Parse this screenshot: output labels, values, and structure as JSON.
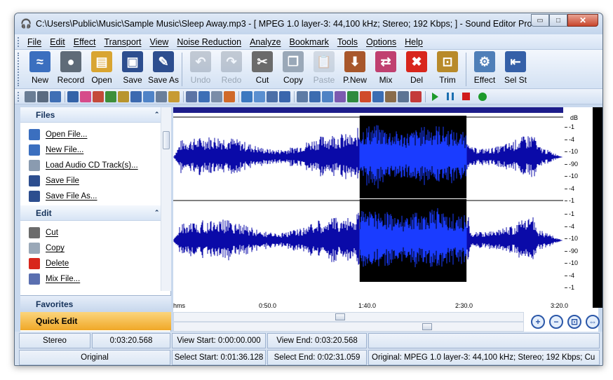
{
  "window": {
    "title": "C:\\Users\\Public\\Music\\Sample Music\\Sleep Away.mp3 - [ MPEG 1.0 layer-3: 44,100 kHz; Stereo; 192 Kbps;  ] - Sound Editor Pro",
    "minimize": "▭",
    "maximize": "□",
    "close": "✕"
  },
  "menu": [
    "File",
    "Edit",
    "Effect",
    "Transport",
    "View",
    "Noise Reduction",
    "Analyze",
    "Bookmark",
    "Tools",
    "Options",
    "Help"
  ],
  "toolbar": [
    {
      "label": "New",
      "icon": "new-file-icon",
      "color": "#3b6fbf",
      "glyph": "≈",
      "enabled": true
    },
    {
      "label": "Record",
      "icon": "microphone-icon",
      "color": "#5f6b78",
      "glyph": "●",
      "enabled": true
    },
    {
      "label": "Open",
      "icon": "open-folder-icon",
      "color": "#d9a531",
      "glyph": "▤",
      "enabled": true
    },
    {
      "label": "Save",
      "icon": "save-icon",
      "color": "#2d4e8f",
      "glyph": "▣",
      "enabled": true
    },
    {
      "label": "Save As",
      "icon": "save-as-icon",
      "color": "#2d4e8f",
      "glyph": "✎",
      "enabled": true
    },
    {
      "label": "Undo",
      "icon": "undo-icon",
      "color": "#6c7a8c",
      "glyph": "↶",
      "enabled": false
    },
    {
      "label": "Redo",
      "icon": "redo-icon",
      "color": "#6c7a8c",
      "glyph": "↷",
      "enabled": false
    },
    {
      "label": "Cut",
      "icon": "scissors-icon",
      "color": "#6b6b6b",
      "glyph": "✂",
      "enabled": true
    },
    {
      "label": "Copy",
      "icon": "copy-icon",
      "color": "#9aa8b8",
      "glyph": "❐",
      "enabled": true
    },
    {
      "label": "Paste",
      "icon": "paste-icon",
      "color": "#9aa8b8",
      "glyph": "📋",
      "enabled": false
    },
    {
      "label": "P.New",
      "icon": "paste-new-icon",
      "color": "#a8572b",
      "glyph": "⬇",
      "enabled": true
    },
    {
      "label": "Mix",
      "icon": "mix-icon",
      "color": "#c04070",
      "glyph": "⇄",
      "enabled": true
    },
    {
      "label": "Del",
      "icon": "delete-icon",
      "color": "#d8261c",
      "glyph": "✖",
      "enabled": true
    },
    {
      "label": "Trim",
      "icon": "trim-icon",
      "color": "#b88a2a",
      "glyph": "⊡",
      "enabled": true
    },
    {
      "label": "Effect",
      "icon": "effect-icon",
      "color": "#4f7fb8",
      "glyph": "⚙",
      "enabled": true
    },
    {
      "label": "Sel St",
      "icon": "select-start-icon",
      "color": "#3560a8",
      "glyph": "⇤",
      "enabled": true
    }
  ],
  "small_toolbar_colors": [
    "#6a7d94",
    "#5a6b80",
    "#3f6fb5",
    "#3463a8",
    "#d64b8a",
    "#c44a3a",
    "#3e8f3a",
    "#b8952e",
    "#3c6ab0",
    "#4f83c7",
    "#6a7f9b",
    "#c79b34",
    "#5b74a5",
    "#3d6fb6",
    "#7a8da8",
    "#d06a2a",
    "#3b78c0",
    "#5a8fd0",
    "#4b6fa8",
    "#3a66ad",
    "#5d7ba5",
    "#3c6cb0",
    "#4e82c4",
    "#7c5ab0",
    "#2f8a3e",
    "#d04b2a",
    "#3b6db3",
    "#8a6c4a",
    "#5c7494",
    "#c43a3a"
  ],
  "sidebar": {
    "files_header": "Files",
    "files_items": [
      {
        "label": "Open File...",
        "icon": "open-file-icon",
        "color": "#3b6fbf"
      },
      {
        "label": "New File...",
        "icon": "new-file-icon",
        "color": "#3b6fbf"
      },
      {
        "label": "Load Audio CD Track(s)...",
        "icon": "cd-icon",
        "color": "#8a9bb0"
      },
      {
        "label": "Save File",
        "icon": "save-icon",
        "color": "#2d4e8f"
      },
      {
        "label": "Save File As...",
        "icon": "save-as-icon",
        "color": "#2d4e8f"
      }
    ],
    "edit_header": "Edit",
    "edit_items": [
      {
        "label": "Cut",
        "icon": "scissors-icon",
        "color": "#6b6b6b"
      },
      {
        "label": "Copy",
        "icon": "copy-icon",
        "color": "#9aa8b8"
      },
      {
        "label": "Delete",
        "icon": "delete-icon",
        "color": "#d8261c"
      },
      {
        "label": "Mix File...",
        "icon": "mix-file-icon",
        "color": "#5a6fb0"
      }
    ],
    "collapse_glyph": "⌃⌃",
    "favorites": "Favorites",
    "quick_edit": "Quick Edit"
  },
  "waveform": {
    "db_labels": [
      "-1",
      "-4",
      "-10",
      "-90",
      "-10",
      "-4",
      "-1"
    ],
    "db_unit": "dB",
    "time_labels": [
      "hms",
      "0:50.0",
      "1:40.0",
      "2:30.0",
      "3:20.0"
    ],
    "selection_start_fraction": 0.478,
    "selection_end_fraction": 0.752,
    "colors": {
      "wave": "#0a0aa8",
      "selected_bg": "#000000",
      "selected_wave": "#1a3cff"
    }
  },
  "status": {
    "row1": [
      "Stereo",
      "0:03:20.568",
      "View Start: 0:00:00.000",
      "View End: 0:03:20.568",
      ""
    ],
    "row2": [
      "Original",
      "Select Start: 0:01:36.128",
      "Select End: 0:02:31.059",
      "Original: MPEG 1.0 layer-3: 44,100 kHz; Stereo; 192 Kbps;  Cu"
    ]
  }
}
